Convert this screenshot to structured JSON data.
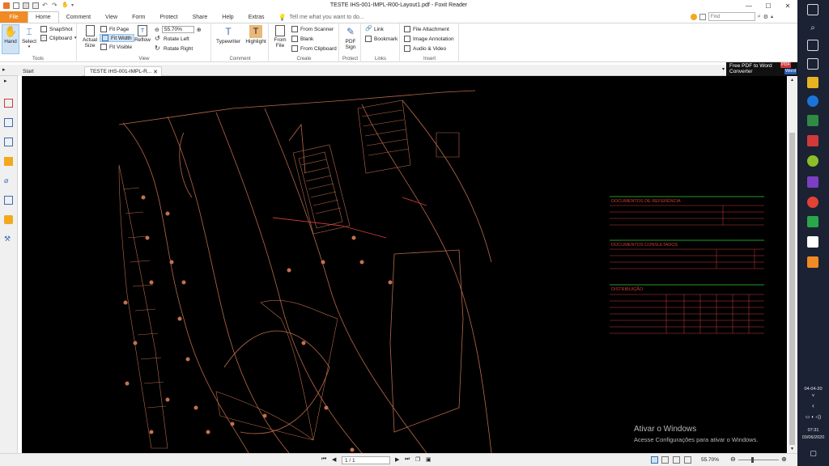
{
  "window": {
    "title": "TESTE IHS-001-IMPL-R00-Layout1.pdf - Foxit Reader"
  },
  "menu": {
    "tabs": [
      "File",
      "Home",
      "Comment",
      "View",
      "Form",
      "Protect",
      "Share",
      "Help",
      "Extras"
    ],
    "tell_me": "Tell me what you want to do...",
    "find_placeholder": "Find"
  },
  "ribbon": {
    "tools": {
      "label": "Tools",
      "hand": "Hand",
      "select": "Select",
      "snapshot": "SnapShot",
      "clipboard": "Clipboard"
    },
    "view": {
      "label": "View",
      "actual_size": "Actual Size",
      "fit_page": "Fit Page",
      "fit_width": "Fit Width",
      "fit_visible": "Fit Visible",
      "reflow": "Reflow",
      "zoom": "55.70%",
      "rotate_left": "Rotate Left",
      "rotate_right": "Rotate Right"
    },
    "comment": {
      "label": "Comment",
      "typewriter": "Typewriter",
      "highlight": "Highlight"
    },
    "create": {
      "label": "Create",
      "from_file": "From File",
      "from_scanner": "From Scanner",
      "blank": "Blank",
      "from_clipboard": "From Clipboard"
    },
    "protect": {
      "label": "Protect",
      "pdf_sign": "PDF Sign"
    },
    "links": {
      "label": "Links",
      "link": "Link",
      "bookmark": "Bookmark"
    },
    "insert": {
      "label": "Insert",
      "file_attachment": "File Attachment",
      "image_annotation": "Image Annotation",
      "audio_video": "Audio & Video"
    }
  },
  "doc_tabs": {
    "start": "Start",
    "current": "TESTE IHS-001-IMPL-R..."
  },
  "promo": {
    "line1": "Free PDF to Word",
    "line2": "Converter",
    "badge1": "PDF",
    "badge2": "Word"
  },
  "drawing": {
    "table1": "DOCUMENTOS DE REFERÊNCIA",
    "table2": "DOCUMENTOS CONSULTADOS",
    "table3": "DISTRIBUIÇÃO"
  },
  "watermark": {
    "title": "Ativar o Windows",
    "subtitle": "Acesse Configurações para ativar o Windows."
  },
  "status": {
    "page": "1 / 1",
    "zoom": "55.70%"
  },
  "taskbar": {
    "date_short": "04-04-20",
    "time": "07:31",
    "date": "03/06/2020"
  },
  "colors": {
    "file_tab": "#f08a24",
    "drawing_lines": "#b8694a",
    "table_green": "#33cc33",
    "table_red": "#d23a3a",
    "canvas": "#000000",
    "taskbar": "#1b2233"
  }
}
